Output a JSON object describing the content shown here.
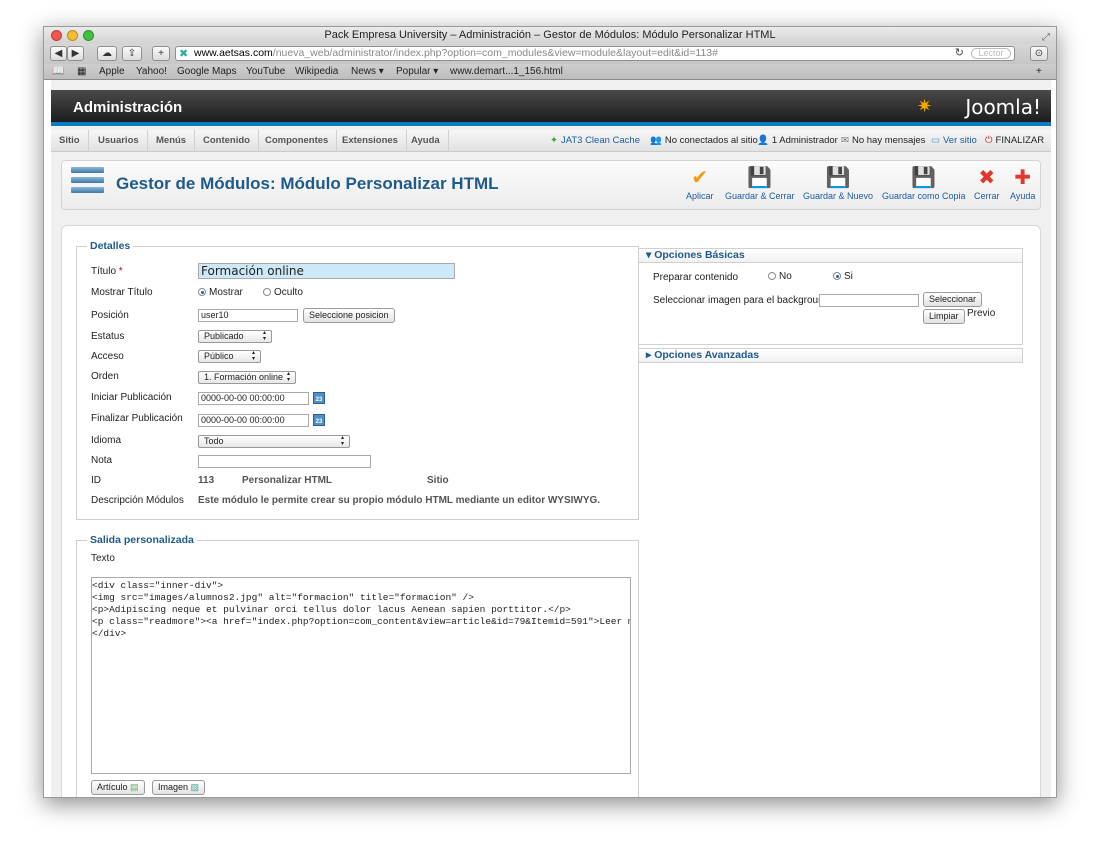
{
  "window": {
    "title": "Pack Empresa University – Administración – Gestor de Módulos: Módulo Personalizar HTML"
  },
  "browser": {
    "url_host": "www.aetsas.com",
    "url_path": "/nueva_web/administrator/index.php?option=com_modules&view=module&layout=edit&id=113#",
    "reader_label": "Lector",
    "bookmarks": [
      "Apple",
      "Yahoo!",
      "Google Maps",
      "YouTube",
      "Wikipedia",
      "News ▾",
      "Popular ▾",
      "www.demart...1_156.html"
    ]
  },
  "header": {
    "title": "Administración",
    "logo": "Joomla!"
  },
  "menu": [
    "Sitio",
    "Usuarios",
    "Menús",
    "Contenido",
    "Componentes",
    "Extensiones",
    "Ayuda"
  ],
  "status": {
    "clean_cache": "JAT3 Clean Cache",
    "not_connected": "No conectados al sitio",
    "admins": "1 Administrador",
    "messages": "No hay mensajes",
    "view_site": "Ver sitio",
    "logout": "FINALIZAR"
  },
  "page": {
    "title": "Gestor de Módulos: Módulo Personalizar HTML"
  },
  "toolbar": {
    "apply": "Aplicar",
    "save_close": "Guardar & Cerrar",
    "save_new": "Guardar & Nuevo",
    "save_copy": "Guardar como Copia",
    "close": "Cerrar",
    "help": "Ayuda"
  },
  "details": {
    "legend": "Detalles",
    "title_label": "Título",
    "title_value": "Formación online",
    "show_title_label": "Mostrar Título",
    "show_option": "Mostrar",
    "hide_option": "Oculto",
    "position_label": "Posición",
    "position_value": "user10",
    "select_position": "Seleccione posicion",
    "status_label": "Estatus",
    "status_value": "Publicado",
    "access_label": "Acceso",
    "access_value": "Público",
    "order_label": "Orden",
    "order_value": "1. Formación online",
    "start_label": "Iniciar Publicación",
    "start_value": "0000-00-00 00:00:00",
    "end_label": "Finalizar Publicación",
    "end_value": "0000-00-00 00:00:00",
    "language_label": "Idioma",
    "language_value": "Todo",
    "note_label": "Nota",
    "id_label": "ID",
    "id_value": "113",
    "id_type": "Personalizar HTML",
    "id_site": "Sitio",
    "desc_label": "Descripción Módulos",
    "desc_value": "Este módulo le permite crear su propio módulo HTML mediante un editor WYSIWYG."
  },
  "custom": {
    "legend": "Salida personalizada",
    "text_label": "Texto",
    "code": "<div class=\"inner-div\">\n<img src=\"images/alumnos2.jpg\" alt=\"formacion\" title=\"formacion\" />\n<p>Adipiscing neque et pulvinar orci tellus dolor lacus Aenean sapien porttitor.</p>\n<p class=\"readmore\"><a href=\"index.php?option=com_content&view=article&id=79&Itemid=591\">Leer más</a></p>\n</div>",
    "article_button": "Artículo",
    "image_button": "Imagen"
  },
  "basic": {
    "title": "Opciones Básicas",
    "prepare_label": "Preparar contenido",
    "no": "No",
    "yes": "Si",
    "bg_label": "Seleccionar imagen para el background",
    "select_button": "Seleccionar",
    "clear_button": "Limpiar",
    "preview": "Previo"
  },
  "advanced": {
    "title": "Opciones Avanzadas"
  }
}
